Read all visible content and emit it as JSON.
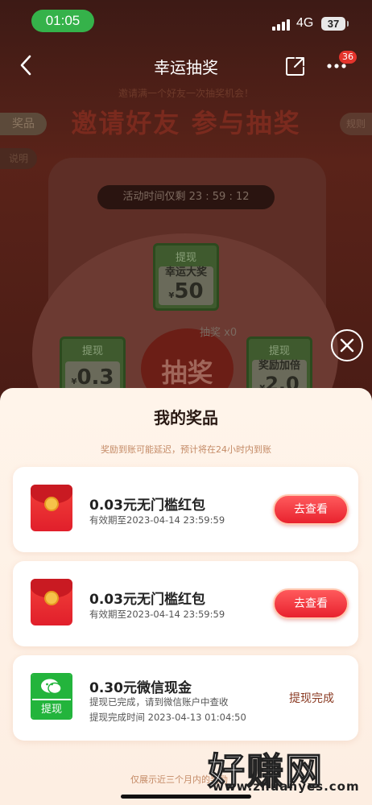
{
  "status_bar": {
    "time": "01:05",
    "network": "4G",
    "battery": "37"
  },
  "nav": {
    "title": "幸运抽奖",
    "more_badge": "36"
  },
  "background": {
    "subtitle": "邀请满一个好友一次抽奖机会！",
    "headline": "邀请好友 参与抽奖",
    "side_tab_left": "奖品",
    "side_tab_left2": "说明",
    "side_tab_right": "规则",
    "timer": "活动时间仅剩 23 : 59 : 12",
    "grand_prize": {
      "head": "提现",
      "label": "幸运大奖",
      "value": "50",
      "currency": "¥"
    },
    "left_prize": {
      "head": "提现",
      "value": "0.3",
      "currency": "¥"
    },
    "right_prize": {
      "head": "提现",
      "label": "奖励加倍",
      "value": "2.0",
      "currency": "¥"
    },
    "draw_button": "抽奖",
    "draw_count": "抽奖 x0"
  },
  "sheet": {
    "title": "我的奖品",
    "note": "奖励到账可能延迟，预计将在24小时内到账",
    "prizes": [
      {
        "name": "0.03元无门槛红包",
        "expiry": "有效期至2023-04-14 23:59:59",
        "action": "去查看"
      },
      {
        "name": "0.03元无门槛红包",
        "expiry": "有效期至2023-04-14 23:59:59",
        "action": "去查看"
      },
      {
        "name": "0.30元微信现金",
        "badge": "提现",
        "line1": "提现已完成，请到微信账户中查收",
        "line2": "提现完成时间 2023-04-13 01:04:50",
        "status": "提现完成"
      }
    ],
    "footer": "仅展示近三个月内的奖励"
  },
  "watermark": {
    "text": "好赚网",
    "url": "www.zhuanyes.com"
  }
}
